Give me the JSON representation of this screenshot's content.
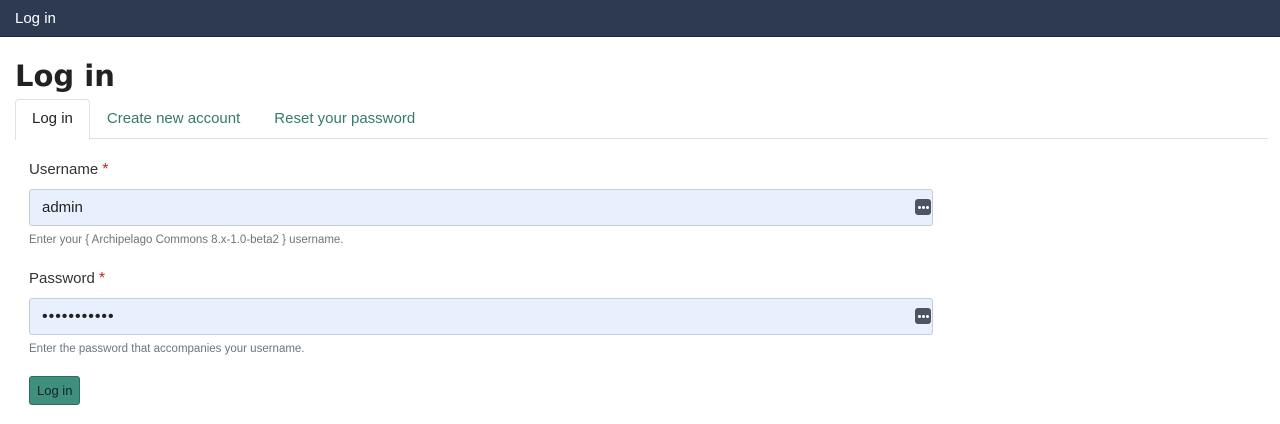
{
  "topbar": {
    "title": "Log in"
  },
  "page": {
    "title": "Log in"
  },
  "tabs": [
    {
      "label": "Log in",
      "active": true
    },
    {
      "label": "Create new account",
      "active": false
    },
    {
      "label": "Reset your password",
      "active": false
    }
  ],
  "form": {
    "username": {
      "label": "Username",
      "required_mark": "*",
      "value": "admin",
      "help": "Enter your { Archipelago Commons 8.x-1.0-beta2 } username.",
      "icon": "password-manager-icon"
    },
    "password": {
      "label": "Password",
      "required_mark": "*",
      "value": "•••••••••••",
      "help": "Enter the password that accompanies your username.",
      "icon": "password-manager-icon"
    },
    "submit_label": "Log in"
  },
  "colors": {
    "topbar_bg": "#2d3a52",
    "link": "#357a6d",
    "input_bg": "#e8effd",
    "required": "#c0262d",
    "button_bg": "#3f8f7e"
  }
}
